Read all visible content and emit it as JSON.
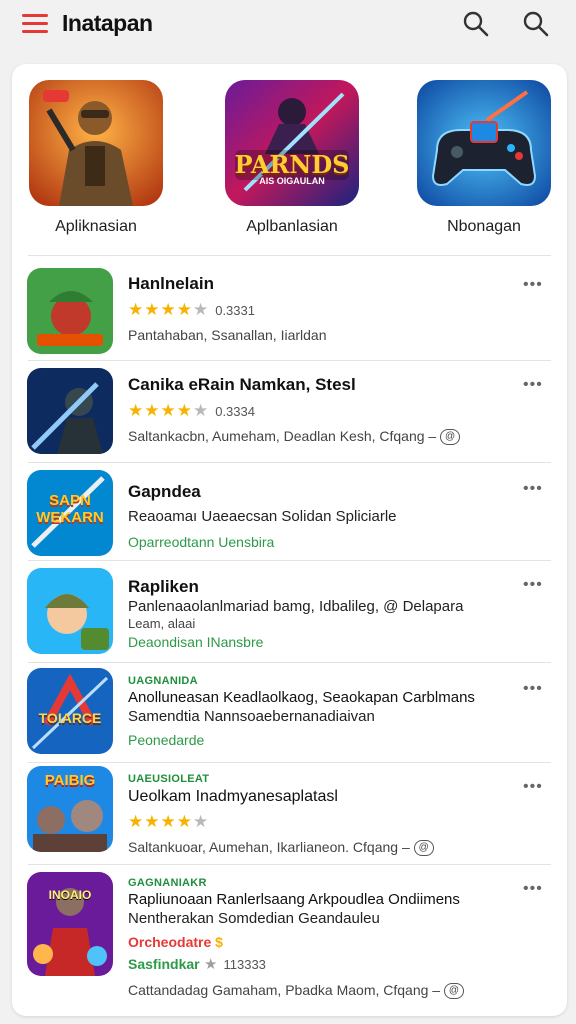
{
  "header": {
    "title": "Inatapan",
    "menu_icon": "menu-icon",
    "search_icon": "search-icon"
  },
  "featured": [
    {
      "label": "Apliknasian"
    },
    {
      "label": "Aplbanlasian",
      "icon_text": "PARNDS",
      "icon_subtext": "AIS OIGAULAN"
    },
    {
      "label": "Nbonagan"
    }
  ],
  "list": [
    {
      "title": "Hanlnelain",
      "rating": "0.3331",
      "meta": "Pantahaban, Ssanallan, Iiarldan"
    },
    {
      "title": "Canika eRain Namkan, Stesl",
      "rating": "0.3334",
      "meta": "Saltankacbn, Aumeham, Deadlan Kesh,  Cfqang –"
    },
    {
      "title": "Gapndea",
      "meta": "Reaoamaı Uaeaecsan Solidan Spliciarle",
      "green": "Oparreodtann Uensbira",
      "icon_text": "SAPN WEKARN"
    },
    {
      "title": "Rapliken",
      "meta": "Panlenaaolanlmariad bamg, Idbalileg, @ Delapara",
      "meta2": "Leam, alaai",
      "green": "Deaondisan INansbre"
    },
    {
      "tag": "UAGNANIDA",
      "title": "Anolluneasan Keadlaolkaog, Seaokapan Carblmans",
      "meta": "Samendtia Nannsoaebernanadiaivan",
      "green": "Peonedarde",
      "icon_text": "TOIARCE"
    },
    {
      "tag": "UAEUSIOLEAT",
      "title": "Ueolkam Inadmyanesaplatasl",
      "meta": "Saltankuoar, Aumehan, Ikarlianeon. Cfqang –",
      "icon_text": "PAIBIG"
    },
    {
      "tag": "GAGNANIAKR",
      "title": "Rapliunoaan Ranlerlsaang Arkpoudlea Ondiimens",
      "meta": "Nentherakan Somdedian Geandauleu",
      "red": "Orcheodatre",
      "green": "Sasfindkar",
      "rating": "113333",
      "meta2": "Cattandadag Gamaham, Pbadka Maom, Cfqang –",
      "icon_text": "INOAIO"
    }
  ],
  "colors": {
    "accent": "#e53935",
    "star": "#f6b400",
    "green": "#2e9a47"
  }
}
